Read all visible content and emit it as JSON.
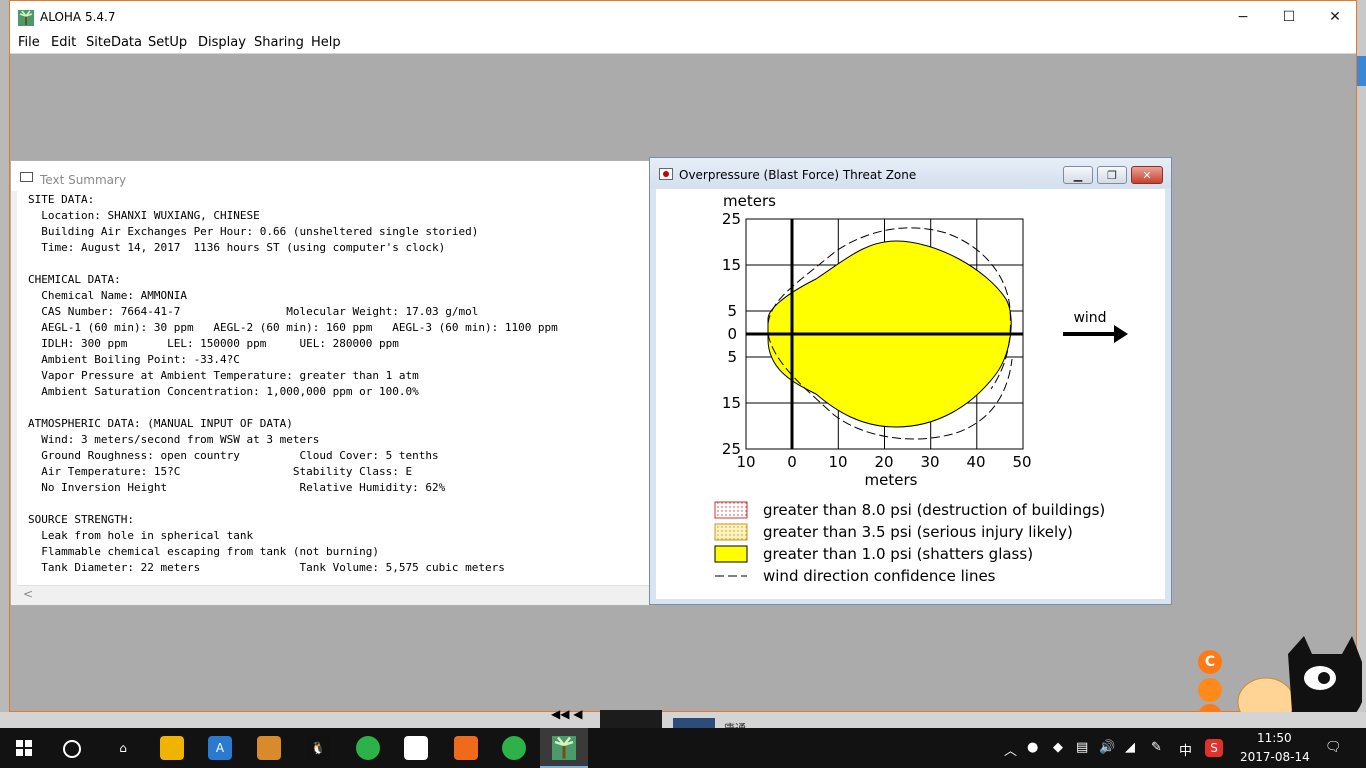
{
  "app": {
    "title": "ALOHA 5.4.7",
    "menu": [
      "File",
      "Edit",
      "SiteData",
      "SetUp",
      "Display",
      "Sharing",
      "Help"
    ],
    "controls": {
      "minimize": "−",
      "maximize": "☐",
      "close": "✕"
    }
  },
  "text_summary": {
    "title": "Text Summary",
    "lines": [
      "SITE DATA:",
      "  Location: SHANXI WUXIANG, CHINESE",
      "  Building Air Exchanges Per Hour: 0.66 (unsheltered single storied)",
      "  Time: August 14, 2017  1136 hours ST (using computer's clock)",
      "",
      "CHEMICAL DATA:",
      "  Chemical Name: AMMONIA",
      "  CAS Number: 7664-41-7                Molecular Weight: 17.03 g/mol",
      "  AEGL-1 (60 min): 30 ppm   AEGL-2 (60 min): 160 ppm   AEGL-3 (60 min): 1100 ppm",
      "  IDLH: 300 ppm      LEL: 150000 ppm     UEL: 280000 ppm",
      "  Ambient Boiling Point: -33.4?C",
      "  Vapor Pressure at Ambient Temperature: greater than 1 atm",
      "  Ambient Saturation Concentration: 1,000,000 ppm or 100.0%",
      "",
      "ATMOSPHERIC DATA: (MANUAL INPUT OF DATA)",
      "  Wind: 3 meters/second from WSW at 3 meters",
      "  Ground Roughness: open country         Cloud Cover: 5 tenths",
      "  Air Temperature: 15?C                 Stability Class: E",
      "  No Inversion Height                    Relative Humidity: 62%",
      "",
      "SOURCE STRENGTH:",
      "  Leak from hole in spherical tank",
      "  Flammable chemical escaping from tank (not burning)",
      "  Tank Diameter: 22 meters               Tank Volume: 5,575 cubic meters"
    ]
  },
  "threat_zone": {
    "title": "Overpressure (Blast Force) Threat Zone",
    "y_unit_label": "meters",
    "x_unit_label": "meters",
    "x_ticks": [
      "10",
      "0",
      "10",
      "20",
      "30",
      "40",
      "50"
    ],
    "y_ticks": [
      "25",
      "15",
      "5",
      "0",
      "5",
      "15",
      "25"
    ],
    "wind_label": "wind",
    "legend": [
      {
        "text": "greater than 8.0 psi (destruction of buildings)",
        "swatch": "red-dotted"
      },
      {
        "text": "greater than 3.5 psi (serious injury likely)",
        "swatch": "orange-dotted"
      },
      {
        "text": "greater than 1.0 psi (shatters glass)",
        "swatch": "yellow"
      },
      {
        "text": "wind direction confidence lines",
        "swatch": "dashed"
      }
    ],
    "zone_color": "#ffff00"
  },
  "taskbar": {
    "time": "11:50",
    "date": "2017-08-14",
    "ime": "中",
    "preview_label": "唐通"
  }
}
